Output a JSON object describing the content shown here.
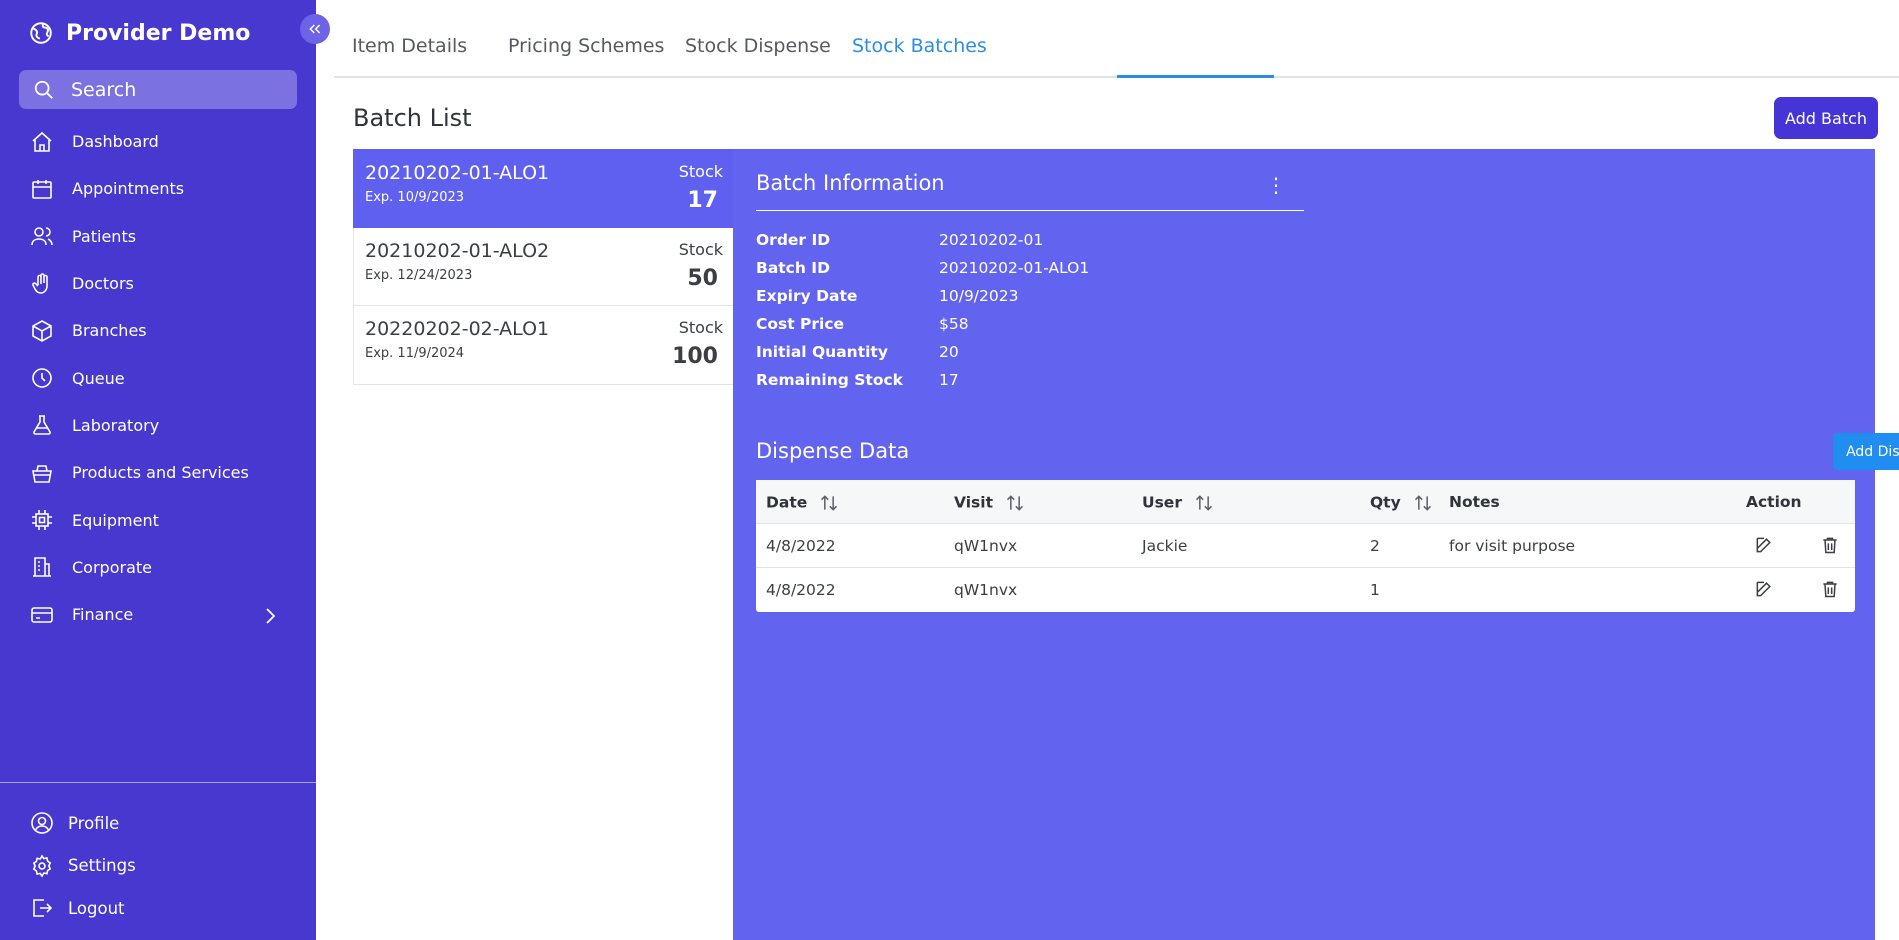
{
  "app": {
    "name": "Provider Demo"
  },
  "search": {
    "placeholder": "Search"
  },
  "sidebar": {
    "items": [
      {
        "label": "Dashboard",
        "icon": "home-icon"
      },
      {
        "label": "Appointments",
        "icon": "calendar-icon"
      },
      {
        "label": "Patients",
        "icon": "users-icon"
      },
      {
        "label": "Doctors",
        "icon": "hand-icon"
      },
      {
        "label": "Branches",
        "icon": "box-icon"
      },
      {
        "label": "Queue",
        "icon": "clock-icon"
      },
      {
        "label": "Laboratory",
        "icon": "flask-icon"
      },
      {
        "label": "Products and Services",
        "icon": "basket-icon"
      },
      {
        "label": "Equipment",
        "icon": "cpu-icon"
      },
      {
        "label": "Corporate",
        "icon": "building-icon"
      },
      {
        "label": "Finance",
        "icon": "credit-card-icon"
      }
    ],
    "bottom": [
      {
        "label": "Profile",
        "icon": "user-circle-icon"
      },
      {
        "label": "Settings",
        "icon": "gear-icon"
      },
      {
        "label": "Logout",
        "icon": "logout-icon"
      }
    ]
  },
  "tabs": [
    {
      "label": "Item Details"
    },
    {
      "label": "Pricing Schemes"
    },
    {
      "label": "Stock Dispense"
    },
    {
      "label": "Stock Batches",
      "active": true
    }
  ],
  "batch_list": {
    "title": "Batch List",
    "add_label": "Add Batch",
    "stock_label": "Stock",
    "items": [
      {
        "id": "20210202-01-ALO1",
        "expiry": "Exp. 10/9/2023",
        "stock": "17",
        "active": true
      },
      {
        "id": "20210202-01-ALO2",
        "expiry": "Exp. 12/24/2023",
        "stock": "50"
      },
      {
        "id": "20220202-02-ALO1",
        "expiry": "Exp. 11/9/2024",
        "stock": "100"
      }
    ]
  },
  "batch_info": {
    "title": "Batch Information",
    "rows": [
      {
        "label": "Order ID",
        "value": "20210202-01"
      },
      {
        "label": "Batch ID",
        "value": "20210202-01-ALO1"
      },
      {
        "label": "Expiry Date",
        "value": "10/9/2023"
      },
      {
        "label": "Cost Price",
        "value": "$58"
      },
      {
        "label": "Initial Quantity",
        "value": "20"
      },
      {
        "label": "Remaining Stock",
        "value": "17"
      }
    ]
  },
  "dispense": {
    "title": "Dispense Data",
    "add_label": "Add Dispense",
    "columns": [
      "Date",
      "Visit",
      "User",
      "Qty",
      "Notes",
      "Action"
    ],
    "rows": [
      {
        "date": "4/8/2022",
        "visit": "qW1nvx",
        "user": "Jackie",
        "qty": "2",
        "notes": "for visit purpose"
      },
      {
        "date": "4/8/2022",
        "visit": "qW1nvx",
        "user": "",
        "qty": "1",
        "notes": ""
      }
    ]
  },
  "colors": {
    "sidebar": "#4738cf",
    "accent": "#2b8ee6",
    "panel": "#6264ef",
    "primary_button": "#4534d6"
  }
}
